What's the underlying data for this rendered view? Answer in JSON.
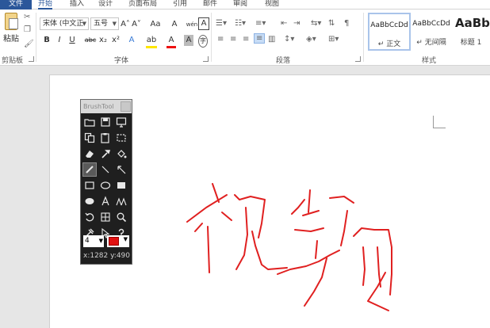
{
  "tabs": {
    "file": "文件",
    "home": "开始",
    "insert": "插入",
    "design": "设计",
    "layout": "页面布局",
    "references": "引用",
    "mailings": "邮件",
    "review": "审阅",
    "view": "视图"
  },
  "clipboard": {
    "paste_label": "粘贴",
    "group_label": "剪贴板"
  },
  "font": {
    "family": "宋体 (中文正",
    "size": "五号",
    "grow": "A˄",
    "shrink": "A˅",
    "change_case": "Aa",
    "clear_format": "A",
    "phonetic": "wén",
    "border_char": "A",
    "bold": "B",
    "italic": "I",
    "underline": "U",
    "strike": "abc",
    "subscript": "x₂",
    "superscript": "x²",
    "text_effect": "A",
    "highlight": "ab",
    "font_color": "A",
    "char_shading": "A",
    "enclose": "字",
    "group_label": "字体"
  },
  "paragraph": {
    "group_label": "段落"
  },
  "styles": {
    "group_label": "样式",
    "items": [
      {
        "sample": "AaBbCcDd",
        "name": "↵ 正文"
      },
      {
        "sample": "AaBbCcDd",
        "name": "↵ 无间隔"
      },
      {
        "sample": "AaBb",
        "name": "标题 1"
      }
    ]
  },
  "brushtool": {
    "title": "BrushTool",
    "brush_size": "4",
    "brush_color": "#e11111",
    "coords": "x:1282 y:490"
  },
  "ink": {
    "color": "#e02020"
  }
}
